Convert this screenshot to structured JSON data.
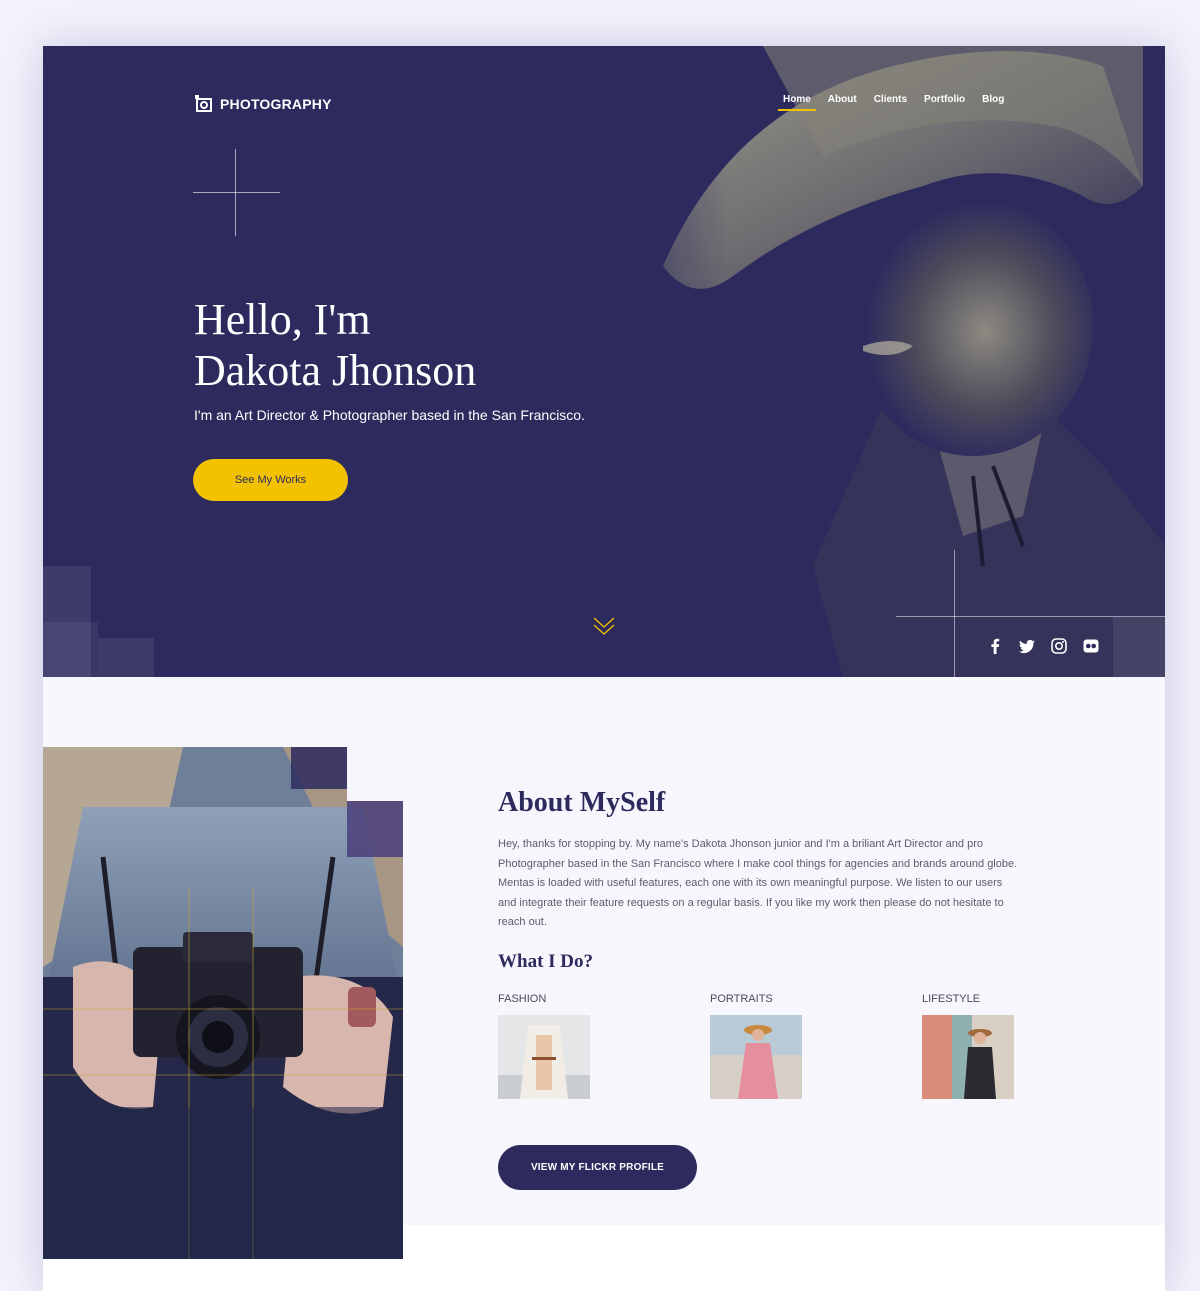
{
  "brand": {
    "name": "PHOTOGRAPHY",
    "icon": "camera-icon"
  },
  "nav": {
    "items": [
      {
        "label": "Home",
        "active": true
      },
      {
        "label": "About",
        "active": false
      },
      {
        "label": "Clients",
        "active": false
      },
      {
        "label": "Portfolio",
        "active": false
      },
      {
        "label": "Blog",
        "active": false
      }
    ]
  },
  "hero": {
    "title": "Hello, I'm\nDakota Jhonson",
    "subtitle": "I'm an Art Director & Photographer based in the San Francisco.",
    "cta_label": "See My Works",
    "scroll_icon": "chevron-down-icon",
    "socials": [
      "facebook-icon",
      "twitter-icon",
      "instagram-icon",
      "flickr-icon"
    ]
  },
  "about": {
    "title": "About MySelf",
    "body": "Hey, thanks for stopping by. My name's Dakota Jhonson junior and I'm a briliant Art Director and pro Photographer based in the San Francisco where I make cool things for agencies and brands around globe. Mentas is loaded with useful features, each one with its own meaningful purpose. We listen to our users and integrate their feature requests on a regular basis. If you like my work then please do not  hesitate to reach out.",
    "what_i_do_title": "What I Do?",
    "services": [
      {
        "label": "FASHION"
      },
      {
        "label": "PORTRAITS"
      },
      {
        "label": "LIFESTYLE"
      }
    ],
    "cta_label": "VIEW MY FLICKR PROFILE"
  },
  "colors": {
    "navy": "#2d2b5e",
    "accent_yellow": "#f2c200",
    "about_bg": "#f7f6fd"
  }
}
